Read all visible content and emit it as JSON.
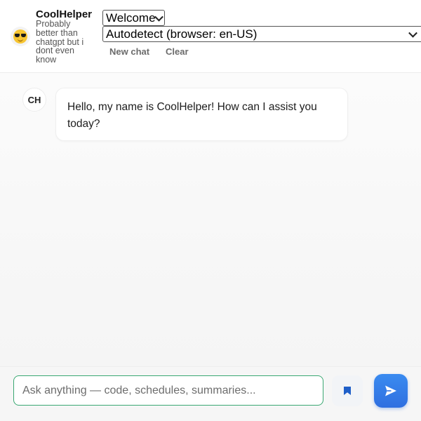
{
  "header": {
    "brand_name": "CoolHelper",
    "tagline": "Probably better than chatgpt but i dont even know",
    "avatar_icon": "sunglasses-emoji-icon",
    "welcome_select": {
      "value": "Welcome"
    },
    "language_select": {
      "value": "Autodetect (browser: en-US)"
    },
    "new_chat_label": "New chat",
    "clear_label": "Clear"
  },
  "messages": [
    {
      "avatar_initials": "CH",
      "text": "Hello, my name is CoolHelper! How can I assist you today?"
    }
  ],
  "composer": {
    "placeholder": "Ask anything — code, schedules, summaries...",
    "value": "",
    "bookmark_icon": "bookmark-icon",
    "send_icon": "send-icon"
  },
  "colors": {
    "accent_blue": "#2f6fe0",
    "input_border_green": "#3aa872",
    "bookmark_blue": "#1f5fc8"
  }
}
